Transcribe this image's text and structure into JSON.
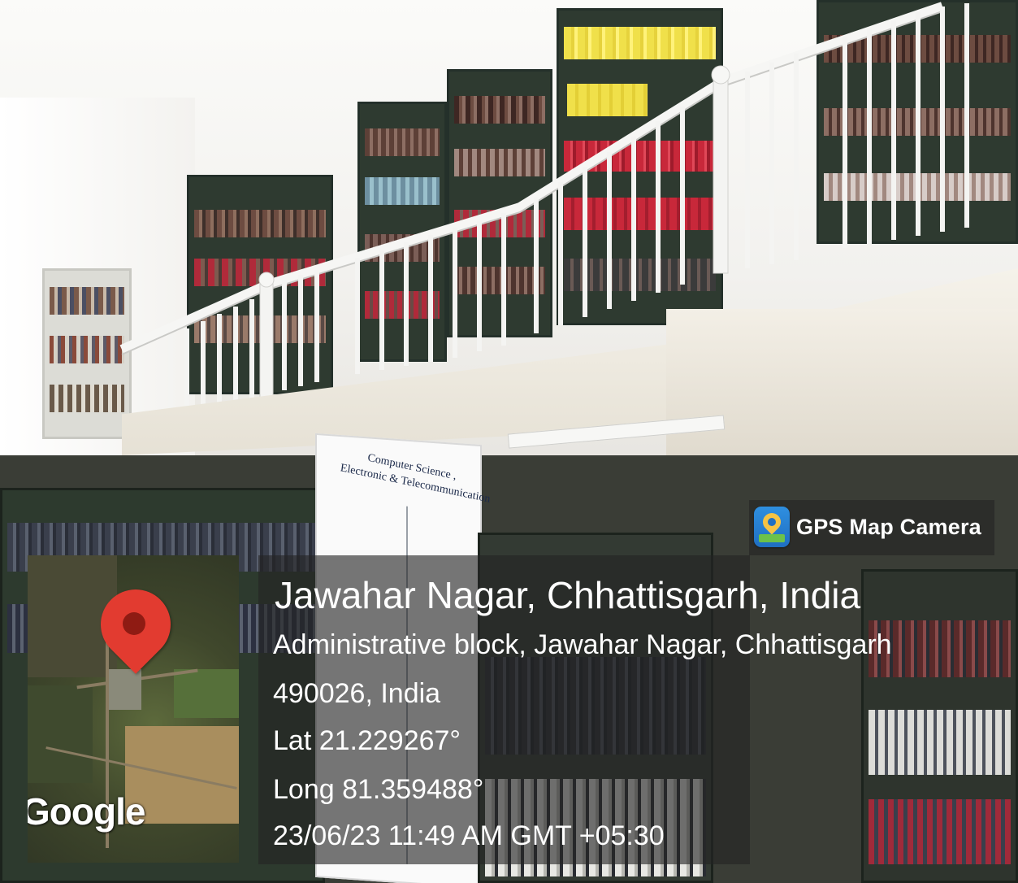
{
  "brand": {
    "label": "GPS Map Camera",
    "icon": "gps-map-camera-app-icon"
  },
  "location": {
    "title": "Jawahar Nagar, Chhattisgarh, India",
    "address_line1": "Administrative block, Jawahar Nagar, Chhattisgarh",
    "address_line2": "490026, India",
    "latitude": "Lat 21.229267°",
    "longitude": "Long 81.359488°",
    "timestamp": "23/06/23 11:49 AM GMT +05:30"
  },
  "map": {
    "attribution": "Google",
    "marker": "location-pin-icon",
    "marker_color": "#e23b30"
  },
  "signage": {
    "line1": "Computer Science ,",
    "line2": "Electronic & Telecommunication"
  },
  "colors": {
    "overlay": "#232323",
    "shelf": "#2e3a30",
    "book_red": "#c8283a",
    "book_yellow": "#f0e04a"
  }
}
